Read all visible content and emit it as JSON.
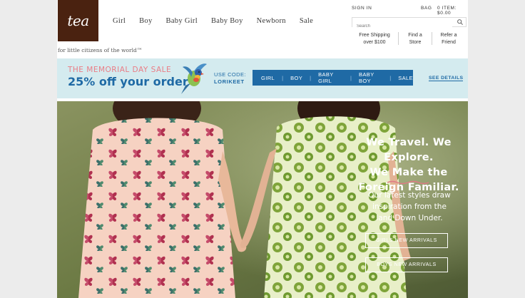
{
  "brand": {
    "logo_text": "tea",
    "tagline": "for little citizens of the world™"
  },
  "main_nav": [
    "Girl",
    "Boy",
    "Baby Girl",
    "Baby Boy",
    "Newborn",
    "Sale"
  ],
  "utility": {
    "sign_in": "SIGN IN",
    "bag": "BAG",
    "items": "0 ITEM: $0.00"
  },
  "search": {
    "placeholder": "Search"
  },
  "sub_nav": {
    "free_shipping": "Free Shipping over $100",
    "find_store": "Find a Store",
    "refer": "Refer a Friend"
  },
  "promo": {
    "line1": "THE MEMORIAL DAY SALE",
    "line2": "25% off your order",
    "code_label": "USE CODE:",
    "code_value": "LORIKEET",
    "links": [
      "GIRL",
      "BOY",
      "BABY GIRL",
      "BABY BOY",
      "SALE"
    ],
    "details": "SEE DETAILS"
  },
  "hero": {
    "headline_1": "We Travel. We Explore.",
    "headline_2": "We Make the",
    "headline_3": "Foreign Familiar.",
    "sub_1": "Our latest styles draw",
    "sub_2": "inspiration from the",
    "sub_3": "land Down Under.",
    "btn_girls": "GIRLS NEW ARRIVALS",
    "btn_boys": "BOYS NEW ARRIVALS"
  },
  "colors": {
    "brand_brown": "#4a2210",
    "promo_bg": "#d4ebef",
    "promo_blue": "#1f6aa5",
    "promo_pink": "#ea7d86"
  }
}
